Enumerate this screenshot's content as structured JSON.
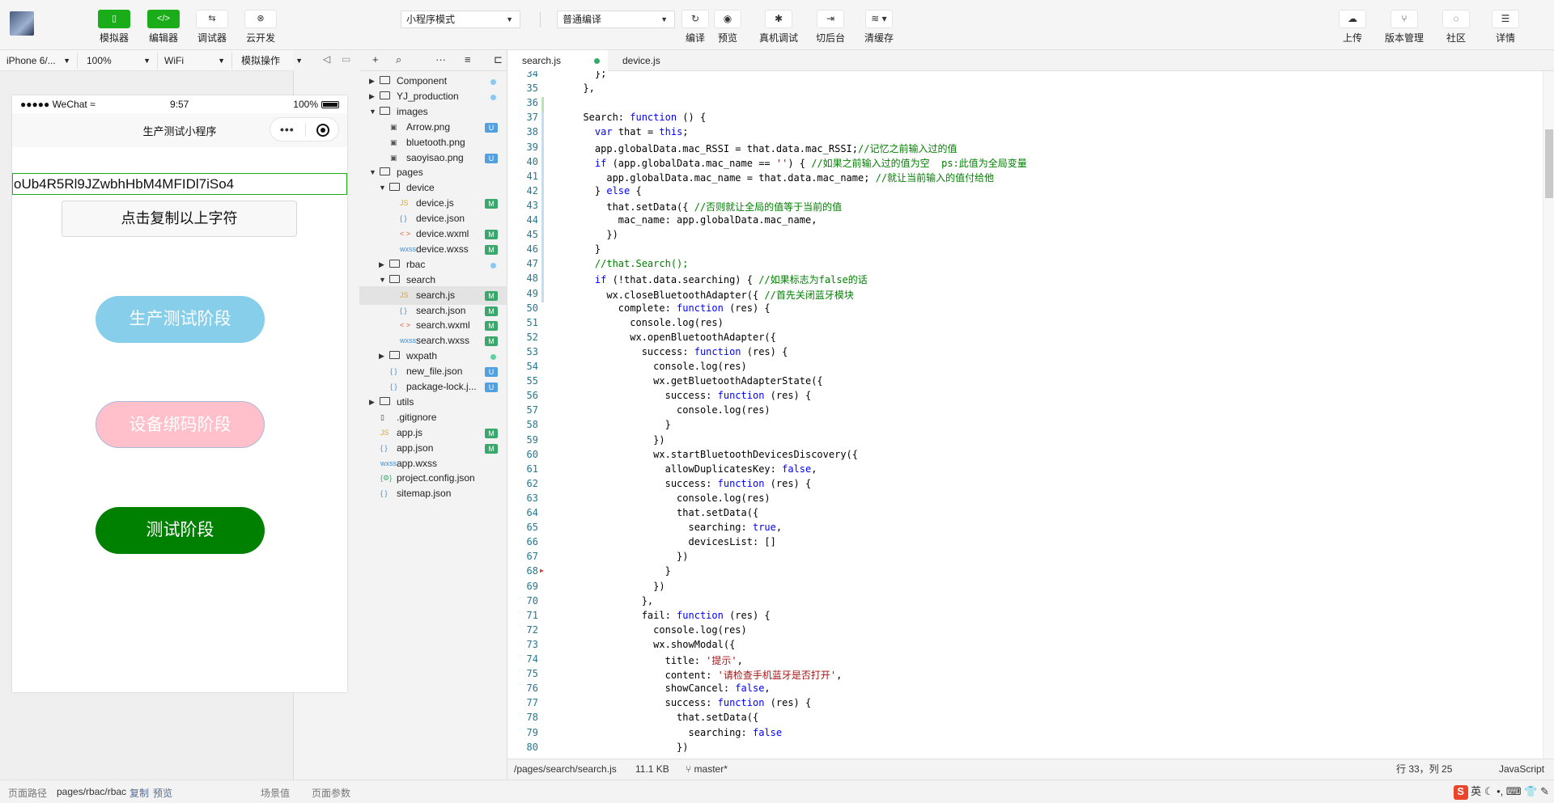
{
  "toolbar": {
    "simulator": "模拟器",
    "editor": "编辑器",
    "debugger": "调试器",
    "cloud": "云开发",
    "mode_select": "小程序模式",
    "compile_select": "普通编译",
    "compile": "编译",
    "preview": "预览",
    "real_debug": "真机调试",
    "background": "切后台",
    "clear_cache": "清缓存",
    "upload": "上传",
    "version": "版本管理",
    "community": "社区",
    "details": "详情"
  },
  "simbar": {
    "device": "iPhone 6/...",
    "zoom": "100%",
    "network": "WiFi",
    "operation": "模拟操作"
  },
  "phone": {
    "carrier": "●●●●● WeChat",
    "time": "9:57",
    "battery": "100%",
    "nav_title": "生产测试小程序",
    "capsule_more": "•••",
    "id_value": "oUb4R5Rl9JZwbhHbM4MFIDl7iSo4",
    "copy_button": "点击复制以上字符",
    "btn_production": "生产测试阶段",
    "btn_binding": "设备绑码阶段",
    "btn_test": "测试阶段"
  },
  "footer": {
    "path_label": "页面路径",
    "path_value": "pages/rbac/rbac",
    "copy": "复制",
    "preview": "预览",
    "scene": "场景值",
    "params": "页面参数"
  },
  "tree": [
    {
      "name": "Component",
      "type": "folder",
      "level": 0,
      "open": false,
      "mark": "dot-blue"
    },
    {
      "name": "YJ_production",
      "type": "folder",
      "level": 0,
      "open": false,
      "mark": "dot-blue"
    },
    {
      "name": "images",
      "type": "folder",
      "level": 0,
      "open": true,
      "mark": ""
    },
    {
      "name": "Arrow.png",
      "type": "img",
      "level": 1,
      "mark": "U"
    },
    {
      "name": "bluetooth.png",
      "type": "img",
      "level": 1,
      "mark": ""
    },
    {
      "name": "saoyisao.png",
      "type": "img",
      "level": 1,
      "mark": "U"
    },
    {
      "name": "pages",
      "type": "folder",
      "level": 0,
      "open": true,
      "mark": ""
    },
    {
      "name": "device",
      "type": "folder",
      "level": 1,
      "open": true,
      "mark": ""
    },
    {
      "name": "device.js",
      "type": "js",
      "level": 2,
      "mark": "M"
    },
    {
      "name": "device.json",
      "type": "json",
      "level": 2,
      "mark": ""
    },
    {
      "name": "device.wxml",
      "type": "wxml",
      "level": 2,
      "mark": "M"
    },
    {
      "name": "device.wxss",
      "type": "wxss",
      "level": 2,
      "mark": "M"
    },
    {
      "name": "rbac",
      "type": "folder",
      "level": 1,
      "open": false,
      "mark": "dot-blue"
    },
    {
      "name": "search",
      "type": "folder",
      "level": 1,
      "open": true,
      "mark": ""
    },
    {
      "name": "search.js",
      "type": "js",
      "level": 2,
      "mark": "M",
      "selected": true
    },
    {
      "name": "search.json",
      "type": "json",
      "level": 2,
      "mark": "M"
    },
    {
      "name": "search.wxml",
      "type": "wxml",
      "level": 2,
      "mark": "M"
    },
    {
      "name": "search.wxss",
      "type": "wxss",
      "level": 2,
      "mark": "M"
    },
    {
      "name": "wxpath",
      "type": "folder",
      "level": 1,
      "open": false,
      "mark": "dot-green"
    },
    {
      "name": "new_file.json",
      "type": "json",
      "level": 1,
      "mark": "U"
    },
    {
      "name": "package-lock.j...",
      "type": "json",
      "level": 1,
      "mark": "U"
    },
    {
      "name": "utils",
      "type": "folder",
      "level": 0,
      "open": false,
      "mark": ""
    },
    {
      "name": ".gitignore",
      "type": "file",
      "level": 0,
      "mark": ""
    },
    {
      "name": "app.js",
      "type": "js",
      "level": 0,
      "mark": "M"
    },
    {
      "name": "app.json",
      "type": "json",
      "level": 0,
      "mark": "M"
    },
    {
      "name": "app.wxss",
      "type": "wxss",
      "level": 0,
      "mark": ""
    },
    {
      "name": "project.config.json",
      "type": "cfg",
      "level": 0,
      "mark": ""
    },
    {
      "name": "sitemap.json",
      "type": "json",
      "level": 0,
      "mark": ""
    }
  ],
  "tabs": [
    {
      "label": "search.js",
      "active": true
    },
    {
      "label": "device.js",
      "active": false
    }
  ],
  "code": [
    {
      "n": "34",
      "t": "    };"
    },
    {
      "n": "35",
      "t": "  },"
    },
    {
      "n": "36",
      "t": ""
    },
    {
      "n": "37",
      "t": "  Search: function () {"
    },
    {
      "n": "38",
      "t": "    var that = this;"
    },
    {
      "n": "39",
      "t": "    app.globalData.mac_RSSI = that.data.mac_RSSI;//记忆之前输入过的值"
    },
    {
      "n": "40",
      "t": "    if (app.globalData.mac_name == '') { //如果之前输入过的值为空  ps:此值为全局变量"
    },
    {
      "n": "41",
      "t": "      app.globalData.mac_name = that.data.mac_name; //就让当前输入的值付给他"
    },
    {
      "n": "42",
      "t": "    } else {"
    },
    {
      "n": "43",
      "t": "      that.setData({ //否则就让全局的值等于当前的值"
    },
    {
      "n": "44",
      "t": "        mac_name: app.globalData.mac_name,"
    },
    {
      "n": "45",
      "t": "      })"
    },
    {
      "n": "46",
      "t": "    }"
    },
    {
      "n": "47",
      "t": "    //that.Search();"
    },
    {
      "n": "48",
      "t": "    if (!that.data.searching) { //如果标志为false的话"
    },
    {
      "n": "49",
      "t": "      wx.closeBluetoothAdapter({ //首先关闭蓝牙模块"
    },
    {
      "n": "50",
      "t": "        complete: function (res) {"
    },
    {
      "n": "51",
      "t": "          console.log(res)"
    },
    {
      "n": "52",
      "t": "          wx.openBluetoothAdapter({"
    },
    {
      "n": "53",
      "t": "            success: function (res) {"
    },
    {
      "n": "54",
      "t": "              console.log(res)"
    },
    {
      "n": "55",
      "t": "              wx.getBluetoothAdapterState({"
    },
    {
      "n": "56",
      "t": "                success: function (res) {"
    },
    {
      "n": "57",
      "t": "                  console.log(res)"
    },
    {
      "n": "58",
      "t": "                }"
    },
    {
      "n": "59",
      "t": "              })"
    },
    {
      "n": "60",
      "t": "              wx.startBluetoothDevicesDiscovery({"
    },
    {
      "n": "61",
      "t": "                allowDuplicatesKey: false,"
    },
    {
      "n": "62",
      "t": "                success: function (res) {"
    },
    {
      "n": "63",
      "t": "                  console.log(res)"
    },
    {
      "n": "64",
      "t": "                  that.setData({"
    },
    {
      "n": "65",
      "t": "                    searching: true,"
    },
    {
      "n": "66",
      "t": "                    devicesList: []"
    },
    {
      "n": "67",
      "t": "                  })"
    },
    {
      "n": "68",
      "t": "                }"
    },
    {
      "n": "69",
      "t": "              })"
    },
    {
      "n": "70",
      "t": "            },"
    },
    {
      "n": "71",
      "t": "            fail: function (res) {"
    },
    {
      "n": "72",
      "t": "              console.log(res)"
    },
    {
      "n": "73",
      "t": "              wx.showModal({"
    },
    {
      "n": "74",
      "t": "                title: '提示',"
    },
    {
      "n": "75",
      "t": "                content: '请检查手机蓝牙是否打开',"
    },
    {
      "n": "76",
      "t": "                showCancel: false,"
    },
    {
      "n": "77",
      "t": "                success: function (res) {"
    },
    {
      "n": "78",
      "t": "                  that.setData({"
    },
    {
      "n": "79",
      "t": "                    searching: false"
    },
    {
      "n": "80",
      "t": "                  })"
    }
  ],
  "status": {
    "path": "/pages/search/search.js",
    "size": "11.1 KB",
    "branch": "master*",
    "position": "行 33，列 25",
    "language": "JavaScript"
  },
  "tray": "英"
}
